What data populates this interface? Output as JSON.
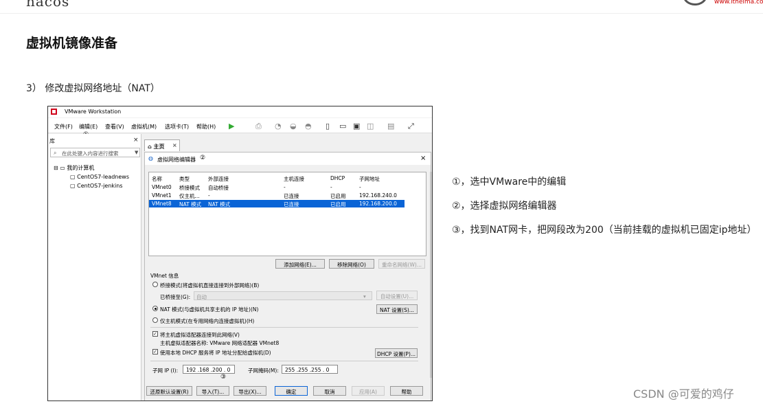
{
  "header": {
    "logo_left": "nacos",
    "logo_url": "www.itheima.com"
  },
  "page": {
    "title": "虚拟机镜像准备",
    "step": "3） 修改虚拟网络地址（NAT）"
  },
  "notes": [
    "①，选中VMware中的编辑",
    "②，选择虚拟网络编辑器",
    "③，找到NAT网卡，把网段改为200（当前挂载的虚拟机已固定ip地址）"
  ],
  "watermark": "CSDN @可爱的鸡仔",
  "vmware": {
    "window_title": "VMware Workstation",
    "menu": [
      "文件(F)",
      "编辑(E)",
      "查看(V)",
      "虚拟机(M)",
      "选项卡(T)",
      "帮助(H)"
    ],
    "sidebar": {
      "title": "库",
      "close": "×",
      "search_placeholder": "在此处键入内容进行搜索",
      "tree": [
        "我的计算机",
        "CentOS7-leadnews",
        "CentOS7-jenkins"
      ]
    },
    "tab": {
      "label": "主页",
      "close": "×"
    },
    "dialog": {
      "title": "虚拟网络编辑器",
      "close": "×",
      "marker1": "①",
      "marker2": "②",
      "marker3": "③",
      "columns": [
        "名称",
        "类型",
        "外部连接",
        "主机连接",
        "DHCP",
        "子网地址"
      ],
      "rows": [
        [
          "VMnet0",
          "桥接模式",
          "自动桥接",
          "-",
          "-",
          "-"
        ],
        [
          "VMnet1",
          "仅主机...",
          "-",
          "已连接",
          "已启用",
          "192.168.240.0"
        ],
        [
          "VMnet8",
          "NAT 模式",
          "NAT 模式",
          "已连接",
          "已启用",
          "192.168.200.0"
        ]
      ],
      "add_network": "添加网络(E)...",
      "remove_network": "移除网络(O)",
      "rename_network": "重命名网络(W)...",
      "vmnet_info": "VMnet 信息",
      "bridge_mode": "桥接模式(将虚拟机直接连接到外部网络)(B)",
      "bridged_to": "已桥接至(G):",
      "bridged_value": "自动",
      "auto_settings": "自动设置(U)...",
      "nat_mode": "NAT 模式(与虚拟机共享主机的 IP 地址)(N)",
      "nat_settings": "NAT 设置(S)...",
      "host_only": "仅主机模式(在专用网络内连接虚拟机)(H)",
      "connect_adapter": "将主机虚拟适配器连接到此网络(V)",
      "adapter_name": "主机虚拟适配器名称: VMware 网络适配器 VMnet8",
      "use_dhcp": "使用本地 DHCP 服务将 IP 地址分配给虚拟机(D)",
      "dhcp_settings": "DHCP 设置(P)...",
      "subnet_ip_label": "子网 IP (I):",
      "subnet_ip": "192 .168 .200 . 0",
      "subnet_mask_label": "子网掩码(M):",
      "subnet_mask": "255 .255 .255 . 0",
      "restore": "还原默认设置(R)",
      "import": "导入(T)...",
      "export": "导出(X)...",
      "ok": "确定",
      "cancel": "取消",
      "apply": "应用(A)",
      "help": "帮助"
    }
  }
}
